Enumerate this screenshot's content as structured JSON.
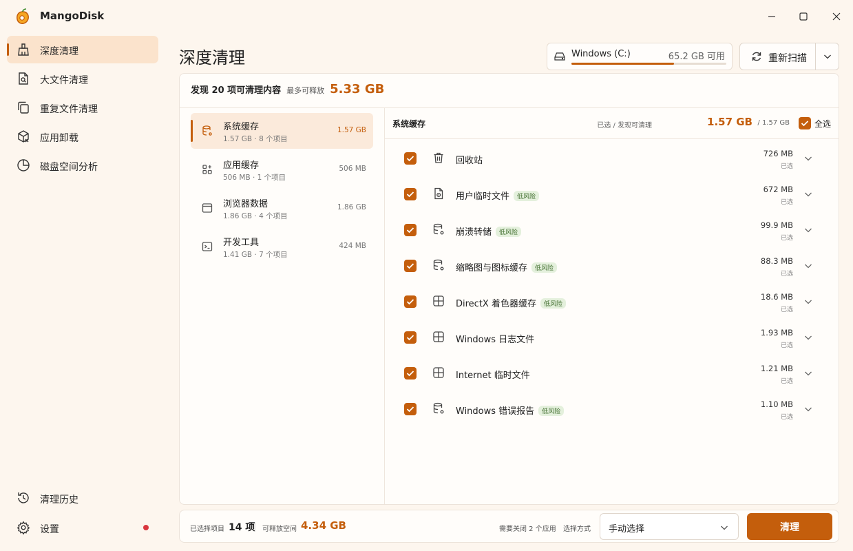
{
  "app": {
    "title": "MangoDisk"
  },
  "sidebar": {
    "items": [
      {
        "label": "深度清理"
      },
      {
        "label": "大文件清理"
      },
      {
        "label": "重复文件清理"
      },
      {
        "label": "应用卸载"
      },
      {
        "label": "磁盘空间分析"
      }
    ],
    "bottom": [
      {
        "label": "清理历史"
      },
      {
        "label": "设置"
      }
    ]
  },
  "header": {
    "title": "深度清理",
    "drive": {
      "name": "Windows (C:)",
      "free": "65.2 GB 可用",
      "used_fraction": 0.66
    },
    "rescan_label": "重新扫描"
  },
  "summary": {
    "main": "发现 20 项可清理内容",
    "sub": "最多可释放",
    "size": "5.33 GB"
  },
  "categories": [
    {
      "name": "系统缓存",
      "meta": "1.57 GB · 8 个项目",
      "size": "1.57 GB",
      "icon": "database-gear-icon"
    },
    {
      "name": "应用缓存",
      "meta": "506 MB · 1 个项目",
      "size": "506 MB",
      "icon": "apps-icon"
    },
    {
      "name": "浏览器数据",
      "meta": "1.86 GB · 4 个项目",
      "size": "1.86 GB",
      "icon": "browser-window-icon"
    },
    {
      "name": "开发工具",
      "meta": "1.41 GB · 7 个项目",
      "size": "424 MB",
      "icon": "terminal-icon"
    }
  ],
  "detail": {
    "title": "系统缓存",
    "selected_label": "已选 / 发现可清理",
    "selected_value": "1.57 GB",
    "total": "/ 1.57 GB",
    "select_all": "全选",
    "items": [
      {
        "name": "回收站",
        "risk": "",
        "size": "726 MB",
        "status": "已选",
        "icon": "trash-icon"
      },
      {
        "name": "用户临时文件",
        "risk": "低风险",
        "size": "672 MB",
        "status": "已选",
        "icon": "file-gear-icon"
      },
      {
        "name": "崩溃转储",
        "risk": "低风险",
        "size": "99.9 MB",
        "status": "已选",
        "icon": "database-gear-icon"
      },
      {
        "name": "缩略图与图标缓存",
        "risk": "低风险",
        "size": "88.3 MB",
        "status": "已选",
        "icon": "database-gear-icon"
      },
      {
        "name": "DirectX 着色器缓存",
        "risk": "低风险",
        "size": "18.6 MB",
        "status": "已选",
        "icon": "windows-icon"
      },
      {
        "name": "Windows 日志文件",
        "risk": "",
        "size": "1.93 MB",
        "status": "已选",
        "icon": "windows-icon"
      },
      {
        "name": "Internet 临时文件",
        "risk": "",
        "size": "1.21 MB",
        "status": "已选",
        "icon": "windows-icon"
      },
      {
        "name": "Windows 错误报告",
        "risk": "低风险",
        "size": "1.10 MB",
        "status": "已选",
        "icon": "database-gear-icon"
      }
    ]
  },
  "footer": {
    "selected_items_label": "已选择项目",
    "selected_items_value": "14 项",
    "releasable_label": "可释放空间",
    "releasable_value": "4.34 GB",
    "close_apps": "需要关闭 2 个应用",
    "mode_label": "选择方式",
    "mode_value": "手动选择",
    "clean_label": "清理"
  },
  "colors": {
    "accent": "#c45e0c",
    "background": "#fdf6ee",
    "active_bg": "#fbe3cc",
    "risk_bg": "#e4f0dc"
  }
}
